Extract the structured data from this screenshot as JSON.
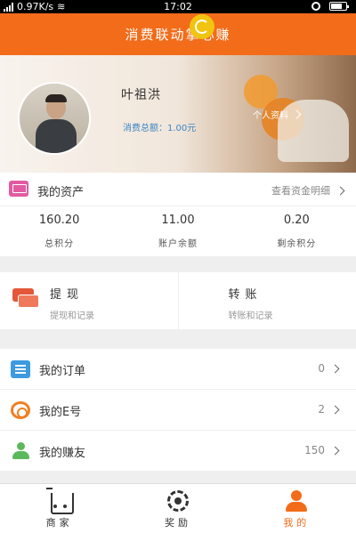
{
  "status_bar": {
    "network_speed": "0.97K/s",
    "time": "17:02"
  },
  "header": {
    "title": "消费联动掌心赚"
  },
  "profile": {
    "name": "叶祖洪",
    "consume_total": "消费总额：1.00元",
    "info_link": "个人资料"
  },
  "assets": {
    "title": "我的资产",
    "detail_link": "查看资金明细",
    "stats": [
      {
        "value": "160.20",
        "label": "总积分"
      },
      {
        "value": "11.00",
        "label": "账户余额"
      },
      {
        "value": "0.20",
        "label": "剩余积分"
      }
    ]
  },
  "operations": [
    {
      "title": "提现",
      "subtitle": "提现和记录"
    },
    {
      "title": "转账",
      "subtitle": "转账和记录"
    }
  ],
  "menu": [
    {
      "label": "我的订单",
      "count": "0"
    },
    {
      "label": "我的E号",
      "count": "2"
    },
    {
      "label": "我的赚友",
      "count": "150"
    }
  ],
  "tabs": [
    {
      "label": "商家"
    },
    {
      "label": "奖励"
    },
    {
      "label": "我的"
    }
  ],
  "colors": {
    "accent": "#f26c1a",
    "link_blue": "#3d86c6"
  }
}
